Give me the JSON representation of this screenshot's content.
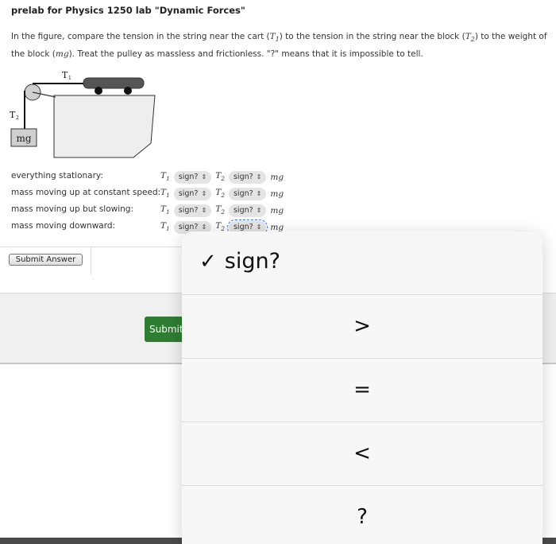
{
  "title": "prelab for Physics 1250 lab \"Dynamic Forces\"",
  "question": {
    "p1": "In the figure, compare the tension in the string near the cart (",
    "t1": "T",
    "t1sub": "1",
    "p2": ") to the tension in the string near the block (",
    "t2": "T",
    "t2sub": "2",
    "p3": ") to the weight of the block (",
    "mg": "mg",
    "p4": "). Treat the pulley as massless and frictionless. \"?\" means that it is impossible to tell."
  },
  "figure": {
    "t1_label": "T",
    "t1_sub": "1",
    "t2_label": "T",
    "t2_sub": "2",
    "block_label": "mg"
  },
  "rows": [
    {
      "label": "everything stationary:",
      "sel1": "sign?",
      "sel2": "sign?"
    },
    {
      "label": "mass moving up at constant speed:",
      "sel1": "sign?",
      "sel2": "sign?"
    },
    {
      "label": "mass moving up but slowing:",
      "sel1": "sign?",
      "sel2": "sign?"
    },
    {
      "label": "mass moving downward:",
      "sel1": "sign?",
      "sel2": "sign?"
    }
  ],
  "vars": {
    "t": "T",
    "sub1": "1",
    "sub2": "2",
    "mg": "mg"
  },
  "submit_answer_label": "Submit Answer",
  "submit_label": "Submit",
  "popover": {
    "check": "✓",
    "options": [
      "sign?",
      ">",
      "=",
      "<",
      "?"
    ]
  },
  "colors": {
    "submit_green": "#2e7d32",
    "focus_outline": "#3a6fd8"
  }
}
